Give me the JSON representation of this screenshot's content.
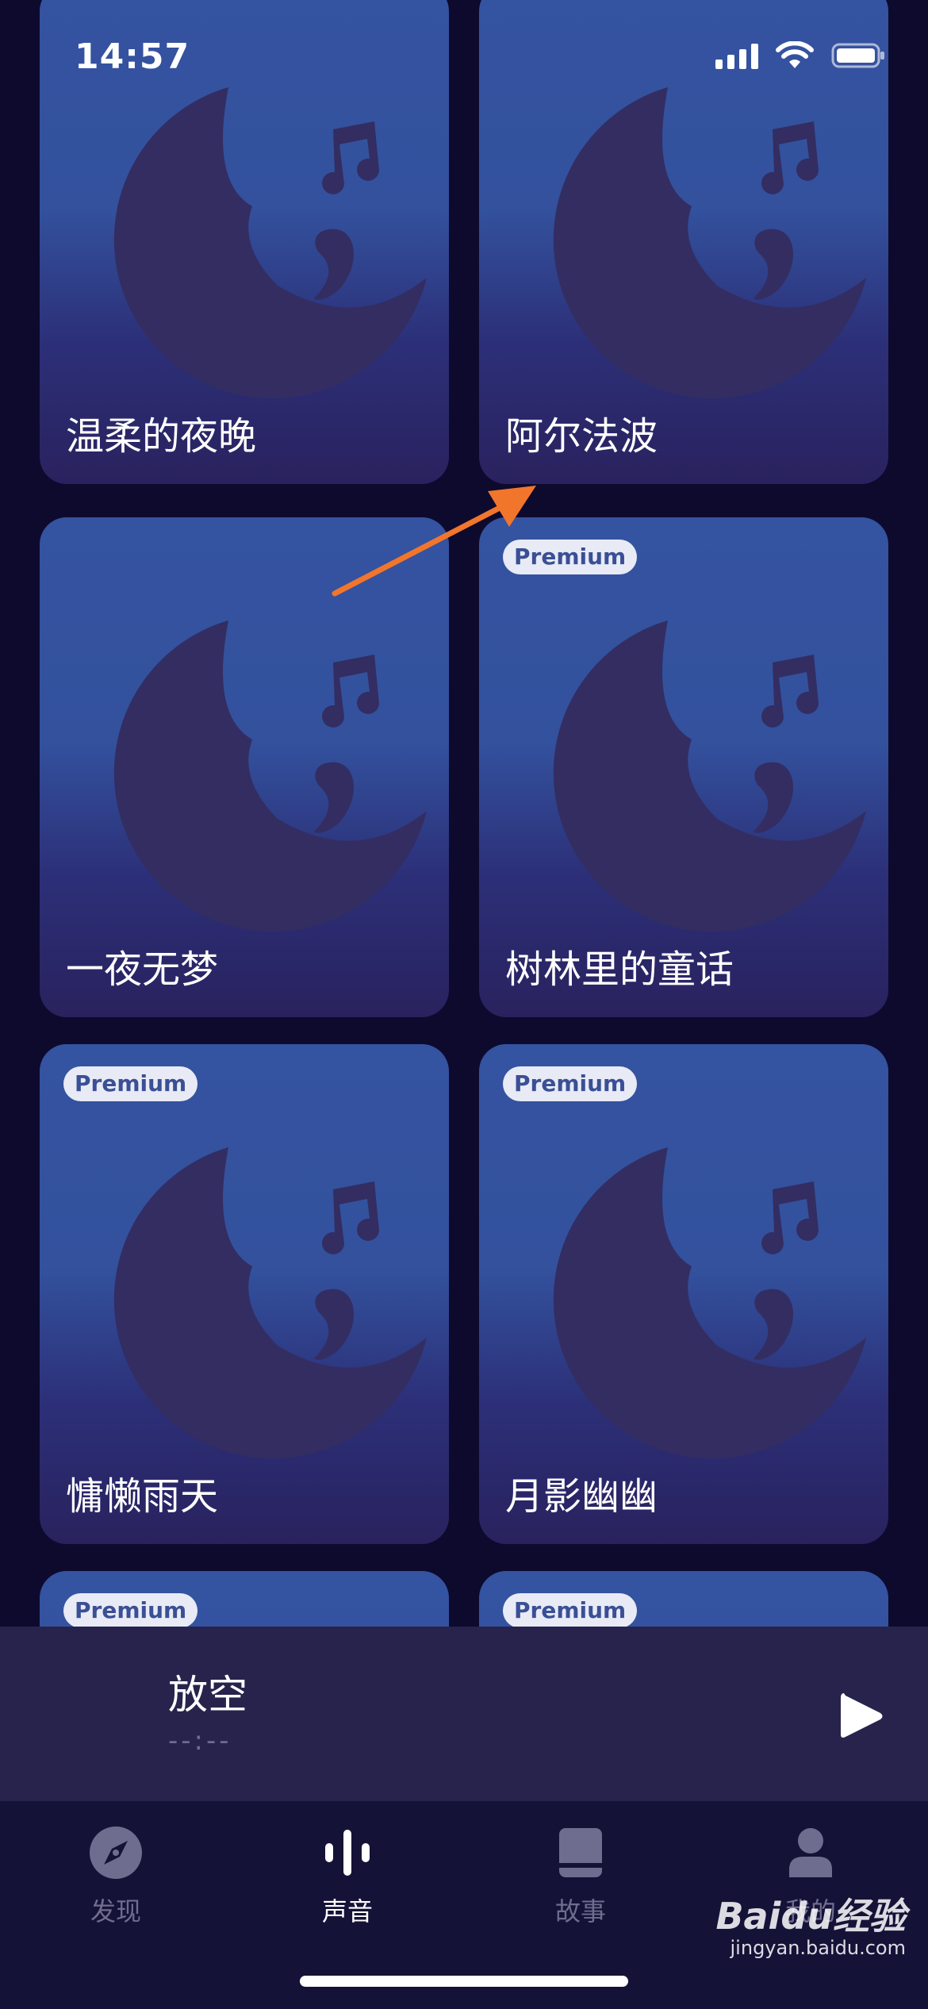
{
  "status_bar": {
    "time": "14:57"
  },
  "cards": [
    {
      "title": "温柔的夜晚",
      "premium": false
    },
    {
      "title": "阿尔法波",
      "premium": false
    },
    {
      "title": "一夜无梦",
      "premium": false
    },
    {
      "title": "树林里的童话",
      "premium": true
    },
    {
      "title": "慵懒雨天",
      "premium": true
    },
    {
      "title": "月影幽幽",
      "premium": true
    },
    {
      "title": "",
      "premium": true
    },
    {
      "title": "",
      "premium": true
    }
  ],
  "premium_label": "Premium",
  "player": {
    "title": "放空",
    "time": "--:--"
  },
  "tabs": [
    {
      "label": "发现",
      "icon": "compass-icon",
      "active": false
    },
    {
      "label": "声音",
      "icon": "sound-waves-icon",
      "active": true
    },
    {
      "label": "故事",
      "icon": "book-icon",
      "active": false
    },
    {
      "label": "我的",
      "icon": "person-icon",
      "active": false
    }
  ],
  "watermark": {
    "logo": "Baidu经验",
    "url": "jingyan.baidu.com"
  },
  "colors": {
    "background": "#0d0a2e",
    "card_top": "#3453a0",
    "card_bottom": "#29225e",
    "moon": "#332d62",
    "player_bg": "#27234d",
    "tabbar_bg": "#151238",
    "inactive_tab": "#6f6d8f",
    "annotation_arrow": "#f2752c"
  }
}
